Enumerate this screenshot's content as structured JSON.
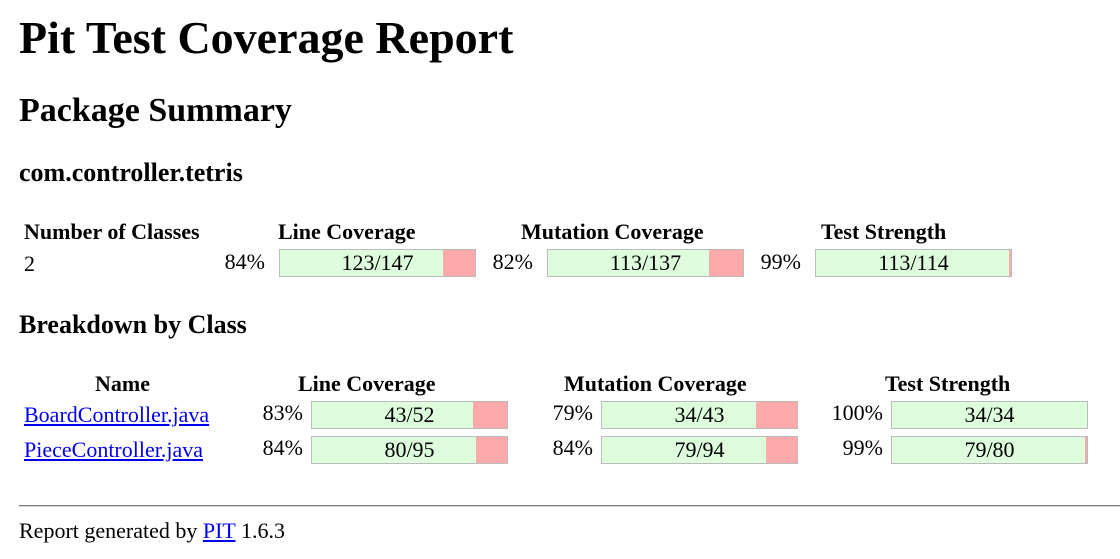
{
  "title": "Pit Test Coverage Report",
  "package_summary": {
    "heading": "Package Summary",
    "package_name": "com.controller.tetris",
    "headers": {
      "classes": "Number of Classes",
      "line": "Line Coverage",
      "mutation": "Mutation Coverage",
      "strength": "Test Strength"
    },
    "classes": "2",
    "line": {
      "percent": "84%",
      "ratio": "123/147",
      "fraction": 0.837
    },
    "mutation": {
      "percent": "82%",
      "ratio": "113/137",
      "fraction": 0.825
    },
    "strength": {
      "percent": "99%",
      "ratio": "113/114",
      "fraction": 0.991
    }
  },
  "breakdown": {
    "heading": "Breakdown by Class",
    "headers": {
      "name": "Name",
      "line": "Line Coverage",
      "mutation": "Mutation Coverage",
      "strength": "Test Strength"
    },
    "rows": [
      {
        "name": "BoardController.java",
        "line": {
          "percent": "83%",
          "ratio": "43/52",
          "fraction": 0.827
        },
        "mutation": {
          "percent": "79%",
          "ratio": "34/43",
          "fraction": 0.791
        },
        "strength": {
          "percent": "100%",
          "ratio": "34/34",
          "fraction": 1.0
        }
      },
      {
        "name": "PieceController.java",
        "line": {
          "percent": "84%",
          "ratio": "80/95",
          "fraction": 0.842
        },
        "mutation": {
          "percent": "84%",
          "ratio": "79/94",
          "fraction": 0.84
        },
        "strength": {
          "percent": "99%",
          "ratio": "79/80",
          "fraction": 0.988
        }
      }
    ]
  },
  "footer": {
    "prefix": "Report generated by",
    "link": "PIT",
    "version": "1.6.3"
  },
  "colors": {
    "covered": "#ddfddd",
    "uncovered": "#ffaaaa",
    "link": "#0000ee"
  }
}
